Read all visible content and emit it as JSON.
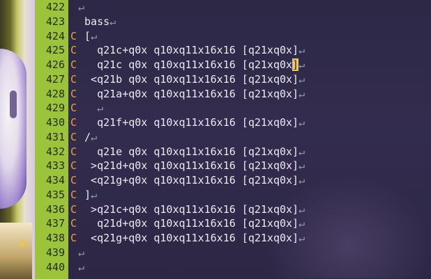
{
  "editor": {
    "eol_glyph": "↵",
    "lines": [
      {
        "num": "422",
        "marker": "",
        "code": ""
      },
      {
        "num": "423",
        "marker": "",
        "code": " bass"
      },
      {
        "num": "424",
        "marker": "C",
        "code": " ["
      },
      {
        "num": "425",
        "marker": "C",
        "code": "   q21c+q0x q10xq11x16x16 [q21xq0x]"
      },
      {
        "num": "426",
        "marker": "C",
        "code": "   q21c q0x q10xq11x16x16 [q21xq0x]",
        "cursor_col": 34
      },
      {
        "num": "427",
        "marker": "C",
        "code": "  <q21b q0x q10xq11x16x16 [q21xq0x]"
      },
      {
        "num": "428",
        "marker": "C",
        "code": "   q21a+q0x q10xq11x16x16 [q21xq0x]"
      },
      {
        "num": "429",
        "marker": "C",
        "code": "   "
      },
      {
        "num": "430",
        "marker": "C",
        "code": "   q21f+q0x q10xq11x16x16 [q21xq0x]"
      },
      {
        "num": "431",
        "marker": "C",
        "code": " /"
      },
      {
        "num": "432",
        "marker": "C",
        "code": "   q21e q0x q10xq11x16x16 [q21xq0x]"
      },
      {
        "num": "433",
        "marker": "C",
        "code": "  >q21d+q0x q10xq11x16x16 [q21xq0x]"
      },
      {
        "num": "434",
        "marker": "C",
        "code": "  <q21g+q0x q10xq11x16x16 [q21xq0x]"
      },
      {
        "num": "435",
        "marker": "C",
        "code": " ]"
      },
      {
        "num": "436",
        "marker": "C",
        "code": "  >q21c+q0x q10xq11x16x16 [q21xq0x]"
      },
      {
        "num": "437",
        "marker": "C",
        "code": "   q21d+q0x q10xq11x16x16 [q21xq0x]"
      },
      {
        "num": "438",
        "marker": "C",
        "code": "  <q21g+q0x q10xq11x16x16 [q21xq0x]"
      },
      {
        "num": "439",
        "marker": "",
        "code": ""
      },
      {
        "num": "440",
        "marker": "",
        "code": ""
      }
    ]
  },
  "colors": {
    "gutter": "#9bc43a",
    "marker": "#f0a030",
    "text": "#eceaf4",
    "cursor": "#f2c75a",
    "eol": "#8f9ab8"
  }
}
